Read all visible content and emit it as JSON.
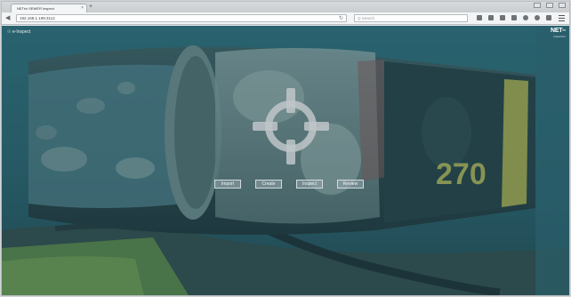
{
  "browser": {
    "tab_title": "NETrix SEWER Inspect",
    "tab_close": "×",
    "new_tab": "+",
    "url": "192.168.1.199:3112",
    "search_placeholder": "Q Search",
    "reload_icon": "↻",
    "back_icon": "◀"
  },
  "app": {
    "brand": "☉ e-Inspect",
    "logo": "NET",
    "logo_suffix": "rix",
    "logo_tagline": "Inspection"
  },
  "actions": [
    {
      "label": "Import"
    },
    {
      "label": "Create"
    },
    {
      "label": "Inspect"
    },
    {
      "label": "Review"
    }
  ],
  "scene": {
    "pipe_marking": "270",
    "overlay_color": "#1e505f",
    "marking_color": "#d8c84a",
    "crosshair_color": "#bfc6c9"
  }
}
